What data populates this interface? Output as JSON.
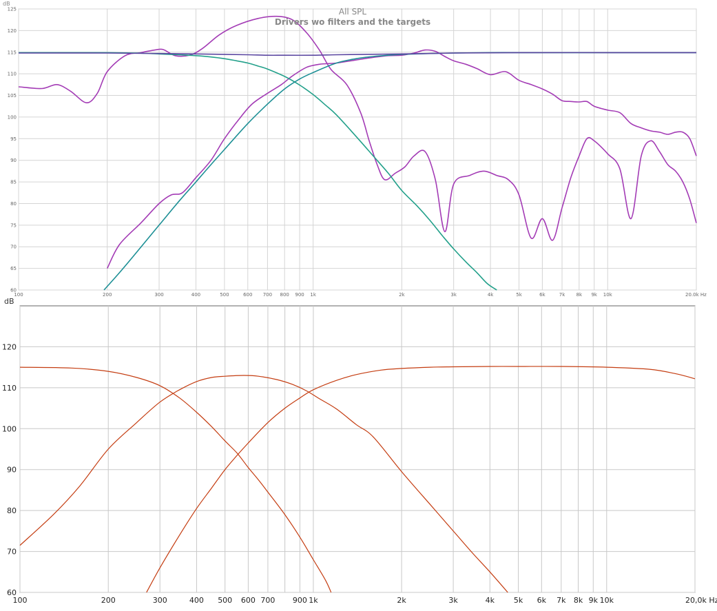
{
  "chart_data": [
    {
      "type": "line",
      "title": "All SPL",
      "subtitle": "Drivers wo filters and the targets",
      "ylabel": "dB",
      "xunit": "Hz",
      "xscale": "log",
      "xlim": [
        100,
        20000
      ],
      "ylim": [
        60,
        125
      ],
      "grid": true,
      "xticks": [
        100,
        200,
        300,
        400,
        500,
        600,
        700,
        800,
        900,
        1000,
        2000,
        3000,
        4000,
        5000,
        6000,
        7000,
        8000,
        9000,
        10000,
        20000
      ],
      "xtick_labels": [
        "100",
        "200",
        "300",
        "400",
        "500",
        "600",
        "700",
        "800",
        "900",
        "1k",
        "2k",
        "3k",
        "4k",
        "5k",
        "6k",
        "7k",
        "8k",
        "9k",
        "10k",
        "20.0k Hz"
      ],
      "yticks": [
        60,
        65,
        70,
        75,
        80,
        85,
        90,
        95,
        100,
        105,
        110,
        115,
        120,
        125
      ],
      "colors": {
        "measured": "#a33bb5",
        "target": "#22a08a",
        "sum": "#5a46a0",
        "grid": "#d4d4d4",
        "text": "#888888"
      },
      "series": [
        {
          "role": "measured",
          "color": "#a33bb5",
          "x": [
            100,
            120,
            135,
            150,
            170,
            185,
            200,
            230,
            260,
            290,
            310,
            340,
            380,
            420,
            480,
            550,
            650,
            750,
            850,
            950,
            1050,
            1150,
            1300,
            1450,
            1550,
            1650,
            1750,
            1900,
            2050,
            2200,
            2400,
            2600,
            2800,
            3000,
            3400,
            3800,
            4200,
            4600,
            5000,
            5500,
            6000,
            6500,
            7000,
            7500,
            8000,
            8500,
            9000,
            10000,
            11000,
            12000,
            13000,
            14000,
            15000,
            16000,
            17000,
            18000,
            19000,
            20000
          ],
          "y": [
            107.0,
            106.6,
            107.5,
            106.0,
            103.3,
            105.5,
            110.5,
            114.2,
            114.9,
            115.5,
            115.6,
            114.2,
            114.3,
            115.8,
            119.0,
            121.2,
            122.8,
            123.3,
            122.5,
            119.5,
            115.5,
            111.0,
            107.5,
            101.0,
            94.5,
            89.0,
            85.5,
            87.0,
            88.5,
            91.0,
            92.0,
            85.5,
            73.5,
            84.5,
            86.5,
            87.5,
            86.5,
            85.5,
            82.0,
            72.0,
            76.5,
            71.5,
            79.0,
            86.0,
            91.0,
            95.0,
            94.5,
            91.5,
            88.0,
            76.5,
            91.0,
            94.5,
            92.0,
            89.0,
            87.5,
            85.0,
            81.0,
            75.5
          ]
        },
        {
          "role": "measured",
          "color": "#a33bb5",
          "x": [
            200,
            220,
            260,
            300,
            330,
            360,
            400,
            450,
            500,
            560,
            620,
            700,
            780,
            850,
            950,
            1050,
            1200,
            1400,
            1600,
            1800,
            2000,
            2200,
            2400,
            2600,
            2800,
            3000,
            3300,
            3600,
            4000,
            4500,
            5000,
            5500,
            6000,
            6500,
            7000,
            7500,
            8000,
            8500,
            9000,
            10000,
            11000,
            12000,
            13000,
            14000,
            15000,
            16000,
            17000,
            18000,
            19000,
            20000
          ],
          "y": [
            65.0,
            70.5,
            75.5,
            80.0,
            82.0,
            82.5,
            86.0,
            90.0,
            95.0,
            99.5,
            103.0,
            105.5,
            107.5,
            109.5,
            111.5,
            112.2,
            112.5,
            113.2,
            113.8,
            114.2,
            114.3,
            114.8,
            115.5,
            115.2,
            114.0,
            113.0,
            112.2,
            111.2,
            109.8,
            110.5,
            108.5,
            107.5,
            106.5,
            105.3,
            103.8,
            103.6,
            103.5,
            103.6,
            102.5,
            101.6,
            101.0,
            98.5,
            97.5,
            96.8,
            96.5,
            96.0,
            96.5,
            96.5,
            95.0,
            91.0
          ]
        },
        {
          "role": "target",
          "color": "#22a08a",
          "x": [
            100,
            150,
            200,
            250,
            300,
            350,
            400,
            450,
            500,
            550,
            600,
            650,
            700,
            800,
            900,
            1000,
            1100,
            1200,
            1400,
            1600,
            1800,
            2000,
            2250,
            2500,
            2750,
            3000,
            3300,
            3600,
            3900,
            4200
          ],
          "y": [
            114.9,
            114.9,
            114.9,
            114.8,
            114.6,
            114.4,
            114.2,
            113.9,
            113.5,
            113.0,
            112.5,
            111.8,
            111.1,
            109.4,
            107.4,
            105.2,
            102.8,
            100.5,
            95.5,
            91.0,
            87.0,
            83.0,
            79.5,
            76.0,
            72.5,
            69.5,
            66.5,
            64.0,
            61.5,
            60.0
          ]
        },
        {
          "role": "target",
          "color": "#1c8f95",
          "x": [
            195,
            220,
            250,
            300,
            350,
            400,
            450,
            500,
            600,
            700,
            800,
            900,
            1000,
            1200,
            1400,
            1600,
            1800,
            2000,
            2500,
            3000,
            4000,
            5000,
            7000,
            10000,
            20000
          ],
          "y": [
            60.0,
            64.0,
            68.5,
            75.0,
            80.5,
            85.0,
            89.0,
            92.5,
            98.5,
            103.0,
            106.5,
            108.8,
            110.3,
            112.5,
            113.5,
            114.0,
            114.3,
            114.5,
            114.7,
            114.8,
            114.9,
            114.9,
            114.9,
            114.9,
            114.9
          ]
        },
        {
          "role": "sum",
          "color": "#5a46a0",
          "x": [
            100,
            200,
            300,
            400,
            500,
            600,
            700,
            800,
            1000,
            1200,
            1500,
            2000,
            3000,
            5000,
            10000,
            20000
          ],
          "y": [
            114.8,
            114.8,
            114.7,
            114.6,
            114.5,
            114.4,
            114.3,
            114.3,
            114.3,
            114.4,
            114.5,
            114.6,
            114.8,
            114.9,
            114.9,
            114.9
          ]
        }
      ]
    },
    {
      "type": "line",
      "ylabel": "dB",
      "xunit": "Hz",
      "xscale": "log",
      "xlim": [
        100,
        20000
      ],
      "ylim": [
        60,
        130
      ],
      "grid": true,
      "xticks": [
        100,
        200,
        300,
        400,
        500,
        600,
        700,
        900,
        1000,
        2000,
        3000,
        4000,
        5000,
        6000,
        7000,
        8000,
        9000,
        10000,
        20000
      ],
      "xtick_labels": [
        "100",
        "200",
        "300",
        "400",
        "500",
        "600",
        "700",
        "900",
        "1k",
        "2k",
        "3k",
        "4k",
        "5k",
        "6k",
        "7k",
        "8k",
        "9k",
        "10k",
        "20,0k Hz"
      ],
      "xgrid": [
        100,
        200,
        300,
        400,
        500,
        600,
        700,
        800,
        900,
        1000,
        2000,
        3000,
        4000,
        5000,
        6000,
        7000,
        8000,
        9000,
        10000,
        20000
      ],
      "yticks": [
        60,
        70,
        80,
        90,
        100,
        110,
        120
      ],
      "colors": {
        "curve": "#c43c10",
        "grid": "#c8c8c8",
        "frame": "#666666"
      },
      "series": [
        {
          "role": "low",
          "color": "#c43c10",
          "x": [
            100,
            150,
            200,
            250,
            300,
            350,
            400,
            450,
            500,
            550,
            600,
            650,
            700,
            800,
            900,
            1000,
            1100,
            1150
          ],
          "y": [
            115.0,
            114.8,
            114.0,
            112.5,
            110.5,
            107.5,
            104.0,
            100.5,
            97.0,
            94.0,
            90.5,
            87.5,
            84.5,
            79.0,
            73.5,
            68.0,
            63.0,
            60.0
          ]
        },
        {
          "role": "mid",
          "color": "#c43c10",
          "x": [
            100,
            130,
            160,
            200,
            250,
            300,
            350,
            400,
            450,
            500,
            580,
            650,
            750,
            850,
            950,
            1050,
            1200,
            1400,
            1600,
            2000,
            2500,
            3000,
            3500,
            4000,
            4600
          ],
          "y": [
            71.5,
            79.0,
            86.0,
            95.0,
            101.5,
            106.5,
            109.5,
            111.5,
            112.5,
            112.8,
            113.0,
            112.8,
            112.0,
            110.8,
            109.2,
            107.3,
            104.8,
            101.0,
            98.0,
            89.5,
            81.5,
            75.0,
            69.5,
            65.0,
            60.0
          ]
        },
        {
          "role": "high",
          "color": "#c43c10",
          "x": [
            270,
            300,
            350,
            400,
            450,
            500,
            550,
            600,
            700,
            800,
            900,
            1000,
            1200,
            1400,
            1700,
            2000,
            2500,
            3000,
            4000,
            5000,
            7000,
            10000,
            14000,
            17000,
            20000
          ],
          "y": [
            60.0,
            66.0,
            74.0,
            80.5,
            85.5,
            90.0,
            93.5,
            96.5,
            101.5,
            105.0,
            107.5,
            109.5,
            111.8,
            113.2,
            114.3,
            114.7,
            115.0,
            115.1,
            115.2,
            115.2,
            115.2,
            115.0,
            114.5,
            113.5,
            112.2
          ]
        }
      ]
    }
  ]
}
